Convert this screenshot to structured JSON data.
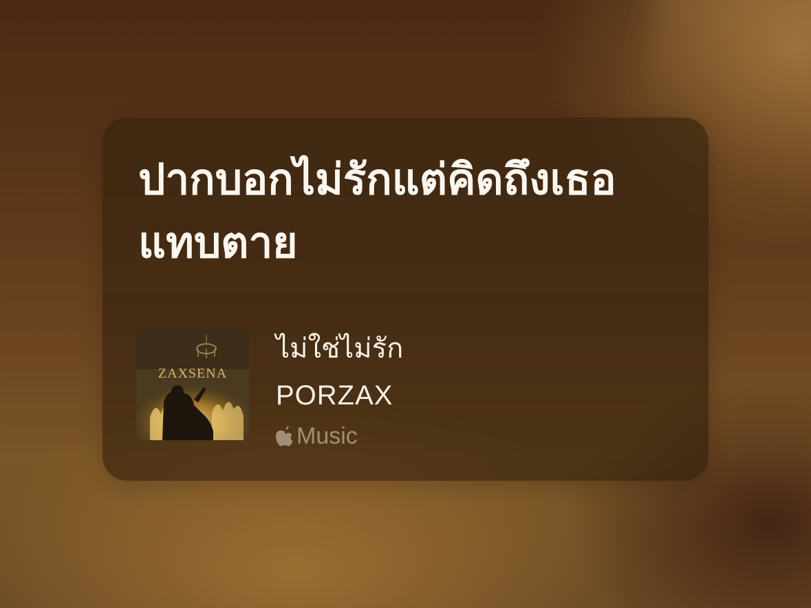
{
  "colors": {
    "background": "#5a3618",
    "card_overlay": "#34220e",
    "lyric_text": "#fbf7f0",
    "song_text": "#f5f0e6",
    "service_text": "#e1d7c8"
  },
  "lyric": {
    "text": "ปากบอกไม่รักแต่คิดถึงเธอแทบตาย"
  },
  "song": {
    "artwork_icon": "album-artwork",
    "artwork_text": "ZAXSENA",
    "title": "ไม่ใช่ไม่รัก",
    "artist": "PORZAX"
  },
  "service": {
    "icon": "apple-logo-icon",
    "label": "Music"
  }
}
